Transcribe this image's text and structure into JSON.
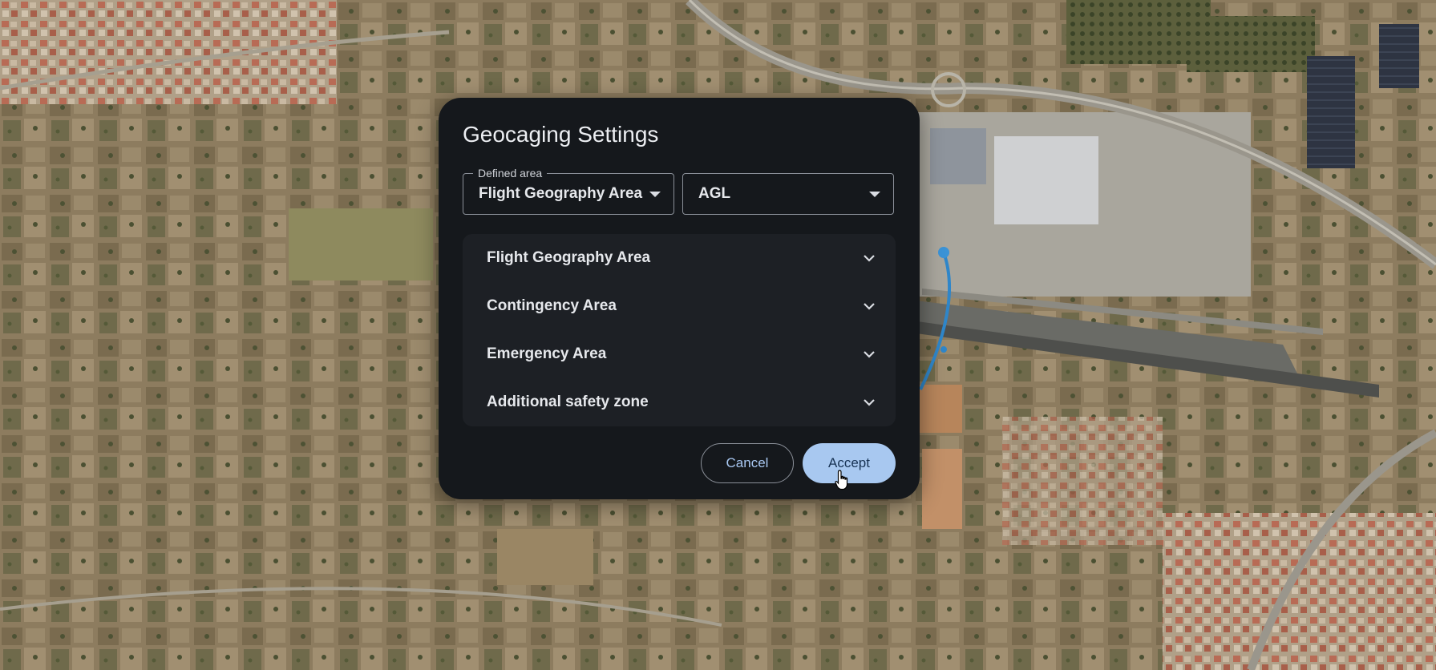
{
  "dialog": {
    "title": "Geocaging Settings",
    "defined_area": {
      "label": "Defined area",
      "value": "Flight Geography Area"
    },
    "altitude_reference": {
      "value": "AGL"
    },
    "sections": [
      {
        "label": "Flight Geography Area",
        "icon": "chevron-down-icon"
      },
      {
        "label": "Contingency Area",
        "icon": "chevron-down-icon"
      },
      {
        "label": "Emergency Area",
        "icon": "chevron-down-icon"
      },
      {
        "label": "Additional safety zone",
        "icon": "chevron-down-icon"
      }
    ],
    "buttons": {
      "cancel": "Cancel",
      "accept": "Accept"
    }
  },
  "colors": {
    "dialog_bg": "#15181c",
    "accordion_bg": "#1d2025",
    "accent": "#a8c8f0",
    "route": "#2f86c9"
  },
  "map": {
    "type": "satellite",
    "route_icon": "waypoint-icon"
  }
}
